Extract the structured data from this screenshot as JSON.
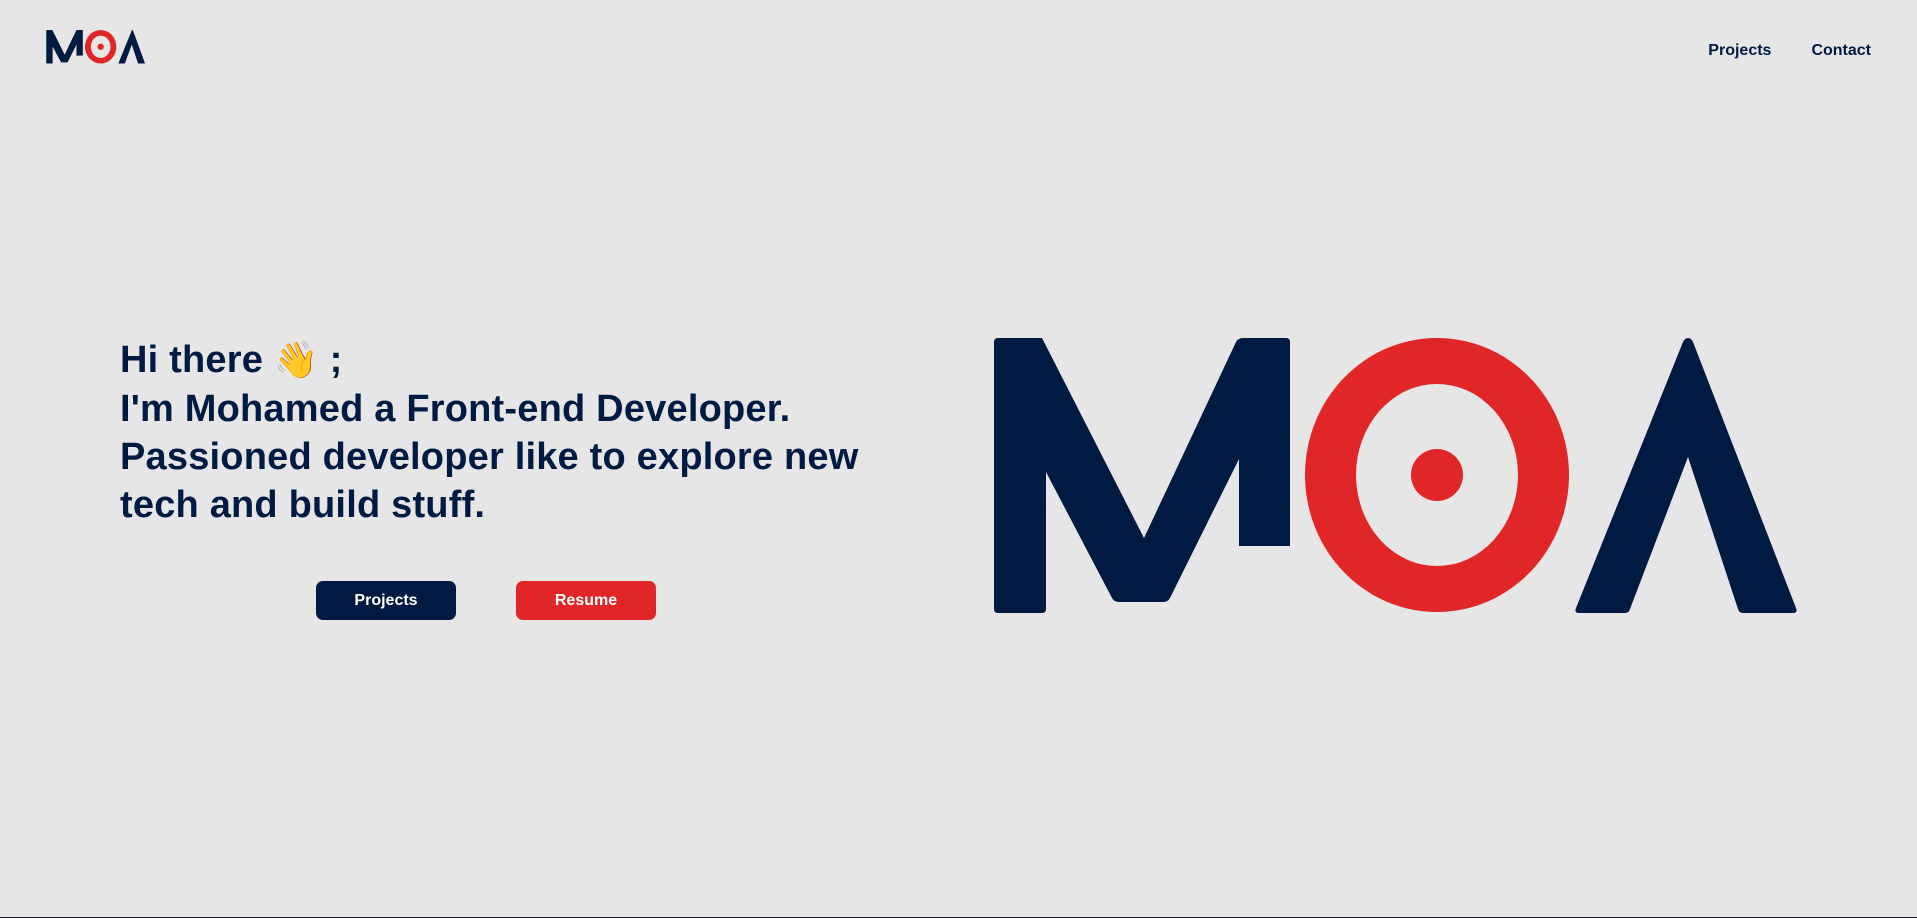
{
  "header": {
    "logo_text": "MOA",
    "nav": [
      {
        "label": "Projects"
      },
      {
        "label": "Contact"
      }
    ]
  },
  "hero": {
    "greeting": "Hi there",
    "wave_emoji": "👋",
    "greeting_suffix": " ;",
    "line2": "I'm Mohamed a Front-end Developer.",
    "line3": "Passioned developer like to explore new",
    "line4": "tech and build stuff.",
    "buttons": {
      "projects_label": "Projects",
      "resume_label": "Resume"
    },
    "logo_text": "MOA"
  },
  "colors": {
    "navy": "#001a42",
    "red": "#e02626",
    "background": "#e6e6e6"
  },
  "icons": {
    "wave": "waving-hand-icon"
  }
}
